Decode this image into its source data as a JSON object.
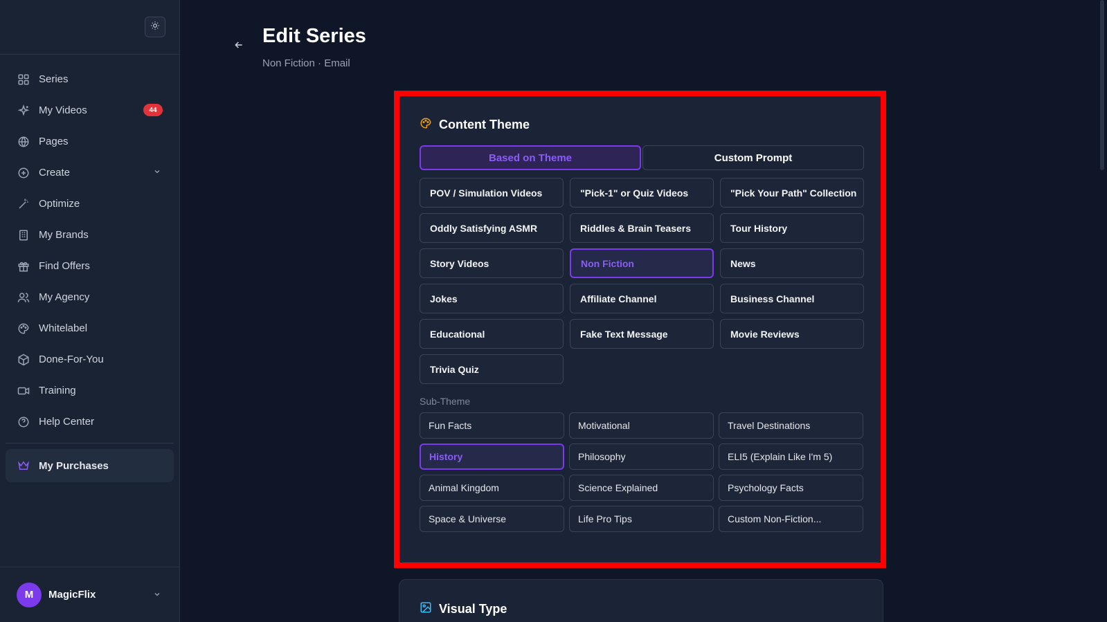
{
  "sidebar": {
    "items": [
      {
        "label": "Series",
        "icon": "grid-icon"
      },
      {
        "label": "My Videos",
        "icon": "sparkles-icon",
        "badge": "44"
      },
      {
        "label": "Pages",
        "icon": "globe-icon"
      },
      {
        "label": "Create",
        "icon": "plus-circle-icon"
      },
      {
        "label": "Optimize",
        "icon": "magic-wand-icon"
      },
      {
        "label": "My Brands",
        "icon": "building-icon"
      },
      {
        "label": "Find Offers",
        "icon": "gift-icon"
      },
      {
        "label": "My Agency",
        "icon": "users-icon"
      },
      {
        "label": "Whitelabel",
        "icon": "palette-icon"
      },
      {
        "label": "Done-For-You",
        "icon": "package-icon"
      },
      {
        "label": "Training",
        "icon": "video-icon"
      },
      {
        "label": "Help Center",
        "icon": "help-circle-icon"
      }
    ],
    "purchases": "My Purchases",
    "user": {
      "initial": "M",
      "name": "MagicFlix"
    }
  },
  "header": {
    "title": "Edit Series",
    "subtitle": "Non Fiction · Email"
  },
  "content_theme": {
    "title": "Content Theme",
    "tabs": [
      "Based on Theme",
      "Custom Prompt"
    ],
    "options": [
      "POV / Simulation Videos",
      "\"Pick-1\" or Quiz Videos",
      "\"Pick Your Path\" Collection",
      "Oddly Satisfying ASMR",
      "Riddles & Brain Teasers",
      "Tour History",
      "Story Videos",
      "Non Fiction",
      "News",
      "Jokes",
      "Affiliate Channel",
      "Business Channel",
      "Educational",
      "Fake Text Message",
      "Movie Reviews",
      "Trivia Quiz"
    ],
    "sub_label": "Sub-Theme",
    "sub_options": [
      "Fun Facts",
      "Motivational",
      "Travel Destinations",
      "History",
      "Philosophy",
      "ELI5 (Explain Like I'm 5)",
      "Animal Kingdom",
      "Science Explained",
      "Psychology Facts",
      "Space & Universe",
      "Life Pro Tips",
      "Custom Non-Fiction..."
    ]
  },
  "visual_type": {
    "title": "Visual Type"
  },
  "colors": {
    "accent": "#7c3aed",
    "badge": "#e0333a",
    "highlight": "#ff0000"
  }
}
